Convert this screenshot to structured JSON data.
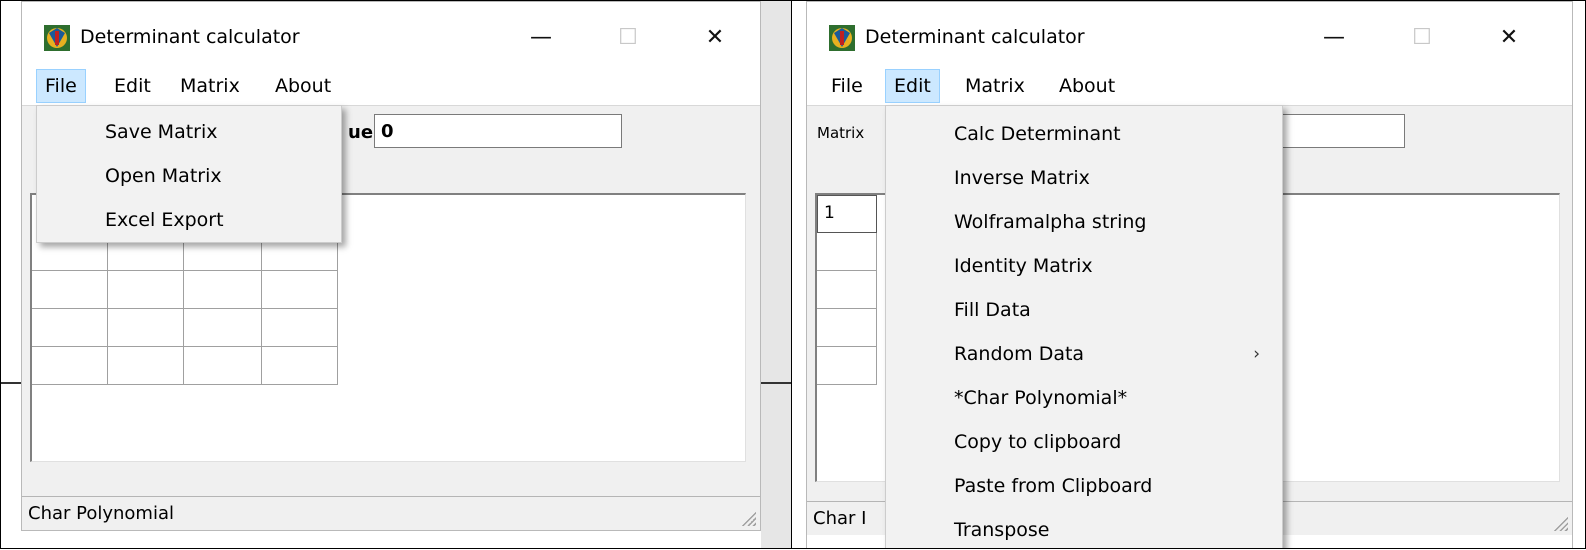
{
  "left": {
    "window_title": "Determinant calculator",
    "menu": [
      "File",
      "Edit",
      "Matrix",
      "About"
    ],
    "active_menu_index": 0,
    "toolbar_label_fragment": "ue",
    "value_input": "0",
    "dropdown_items": [
      "Save Matrix",
      "Open Matrix",
      "Excel Export"
    ],
    "status_text": "Char Polynomial"
  },
  "right": {
    "window_title": "Determinant calculator",
    "menu": [
      "File",
      "Edit",
      "Matrix",
      "About"
    ],
    "active_menu_index": 1,
    "toolbar_label_fragment": "Matrix",
    "first_cell_value": "1",
    "dropdown_items": [
      {
        "label": "Calc Determinant"
      },
      {
        "label": "Inverse Matrix"
      },
      {
        "label": "Wolframalpha string"
      },
      {
        "label": "Identity Matrix"
      },
      {
        "label": "Fill Data"
      },
      {
        "label": "Random Data",
        "submenu_glyph": "›"
      },
      {
        "label": "*Char Polynomial*"
      },
      {
        "label": "Copy to clipboard"
      },
      {
        "label": "Paste from Clipboard"
      },
      {
        "label": "Transpose"
      }
    ],
    "status_fragment": "Char I"
  },
  "window_controls": {
    "minimize": "—",
    "maximize": "☐",
    "close": "✕"
  },
  "colors": {
    "menu_highlight": "#cce8ff",
    "menu_highlight_border": "#99d1ff",
    "chrome_bg": "#f0f0f0"
  }
}
